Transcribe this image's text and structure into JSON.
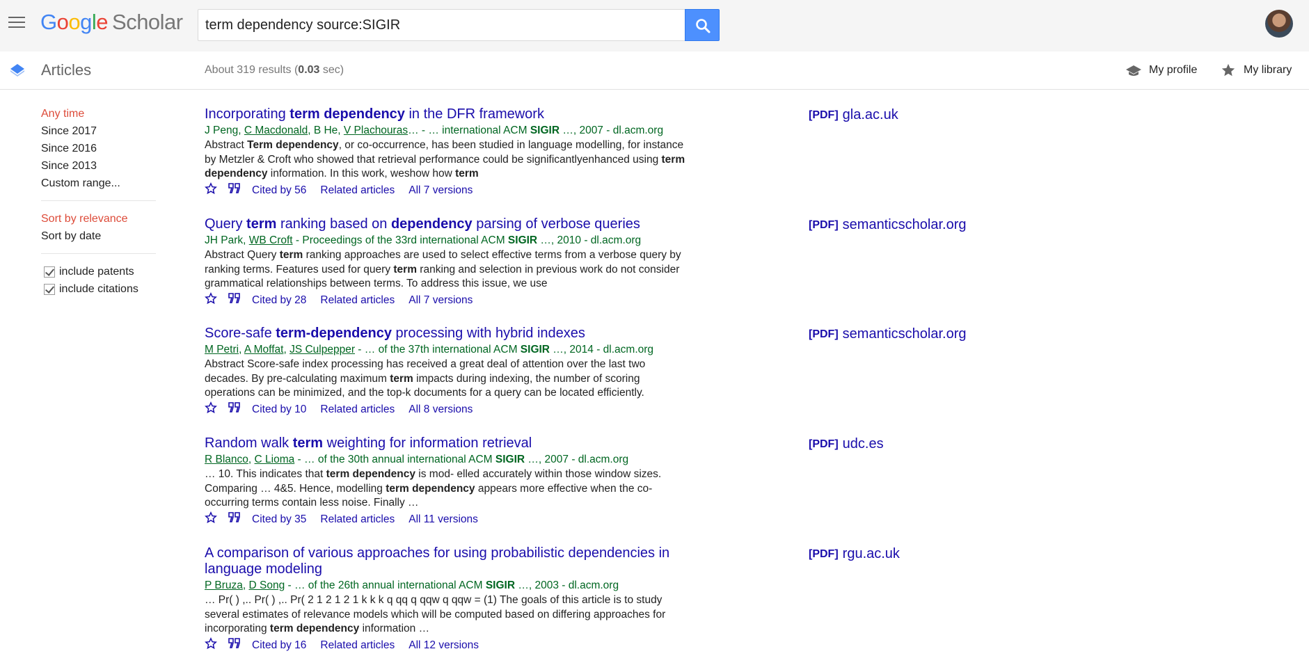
{
  "logo": {
    "g1": "G",
    "g2": "o",
    "g3": "o",
    "g4": "g",
    "g5": "l",
    "g6": "e",
    "scholar": "Scholar"
  },
  "search": {
    "query": "term dependency source:SIGIR"
  },
  "subbar": {
    "section_title": "Articles",
    "results_prefix": "About 319 results (",
    "results_time": "0.03",
    "results_suffix": " sec)",
    "my_profile": "My profile",
    "my_library": "My library"
  },
  "sidebar": {
    "time_filters": [
      "Any time",
      "Since 2017",
      "Since 2016",
      "Since 2013",
      "Custom range..."
    ],
    "sort_options": [
      "Sort by relevance",
      "Sort by date"
    ],
    "checkboxes": [
      "include patents",
      "include citations"
    ]
  },
  "results": [
    {
      "title_html": "Incorporating <b>term dependency</b> in the DFR framework",
      "authors_html": "J Peng, <u>C Macdonald</u>, B He, <u>V Plachouras</u>… - … international ACM <b>SIGIR</b> …, 2007 - dl.acm.org",
      "snippet_html": "Abstract <b>Term dependency</b>, or co-occurrence, has been studied in language modelling, for instance by Metzler &amp; Croft who showed that retrieval performance could be significantlyenhanced using <b>term dependency</b> information. In this work, weshow how <b>term</b>",
      "cited": "Cited by 56",
      "related": "Related articles",
      "versions": "All 7 versions",
      "pdf_tag": "[PDF]",
      "pdf_source": "gla.ac.uk"
    },
    {
      "title_html": "Query <b>term</b> ranking based on <b>dependency</b> parsing of verbose queries",
      "authors_html": "JH Park, <u>WB Croft</u> - Proceedings of the 33rd international ACM <b>SIGIR</b> …, 2010 - dl.acm.org",
      "snippet_html": "Abstract Query <b>term</b> ranking approaches are used to select effective terms from a verbose query by ranking terms. Features used for query <b>term</b> ranking and selection in previous work do not consider grammatical relationships between terms. To address this issue, we use",
      "cited": "Cited by 28",
      "related": "Related articles",
      "versions": "All 7 versions",
      "pdf_tag": "[PDF]",
      "pdf_source": "semanticscholar.org"
    },
    {
      "title_html": "Score-safe <b>term-dependency</b> processing with hybrid indexes",
      "authors_html": "<u>M Petri</u>, <u>A Moffat</u>, <u>JS Culpepper</u> - … of the 37th international ACM <b>SIGIR</b> …, 2014 - dl.acm.org",
      "snippet_html": "Abstract Score-safe index processing has received a great deal of attention over the last two decades. By pre-calculating maximum <b>term</b> impacts during indexing, the number of scoring operations can be minimized, and the top-k documents for a query can be located efficiently.",
      "cited": "Cited by 10",
      "related": "Related articles",
      "versions": "All 8 versions",
      "pdf_tag": "[PDF]",
      "pdf_source": "semanticscholar.org"
    },
    {
      "title_html": "Random walk <b>term</b> weighting for information retrieval",
      "authors_html": "<u>R Blanco</u>, <u>C Lioma</u> - … of the 30th annual international ACM <b>SIGIR</b> …, 2007 - dl.acm.org",
      "snippet_html": "… 10. This indicates that <b>term dependency</b> is mod- elled accurately within those window sizes. Comparing … 4&amp;5. Hence, modelling <b>term dependency</b> appears more effective when the co-occurring terms contain less noise. Finally …",
      "cited": "Cited by 35",
      "related": "Related articles",
      "versions": "All 11 versions",
      "pdf_tag": "[PDF]",
      "pdf_source": "udc.es"
    },
    {
      "title_html": "A comparison of various approaches for using probabilistic dependencies in language modeling",
      "authors_html": "<u>P Bruza</u>, <u>D Song</u> - … of the 26th annual international ACM <b>SIGIR</b> …, 2003 - dl.acm.org",
      "snippet_html": "… Pr( ) ,.. Pr( ) ,.. Pr( 2 1 2 1 2 1 k k k q qq q qqw q qqw = (1) The goals of this article is to study several estimates of relevance models which will be computed based on differing approaches for incorporating <b>term dependency</b> information …",
      "cited": "Cited by 16",
      "related": "Related articles",
      "versions": "All 12 versions",
      "pdf_tag": "[PDF]",
      "pdf_source": "rgu.ac.uk"
    }
  ]
}
